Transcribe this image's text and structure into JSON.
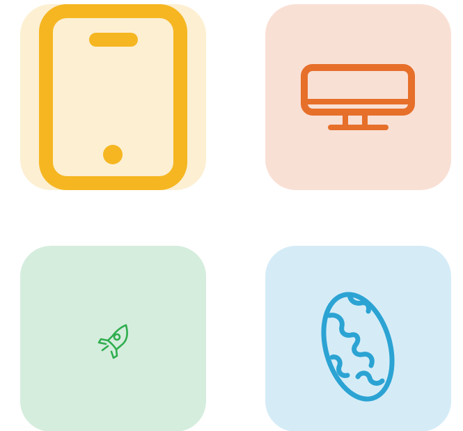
{
  "tiles": [
    {
      "icon": "smartphone-icon",
      "background": "#FDEFD2",
      "color": "#F5B621"
    },
    {
      "icon": "monitor-icon",
      "background": "#F9E0D5",
      "color": "#E66F2A"
    },
    {
      "icon": "rocket-icon",
      "background": "#D5EDDD",
      "color": "#2EAD4D"
    },
    {
      "icon": "globe-icon",
      "background": "#D5ECF7",
      "color": "#2BA3D3"
    }
  ]
}
